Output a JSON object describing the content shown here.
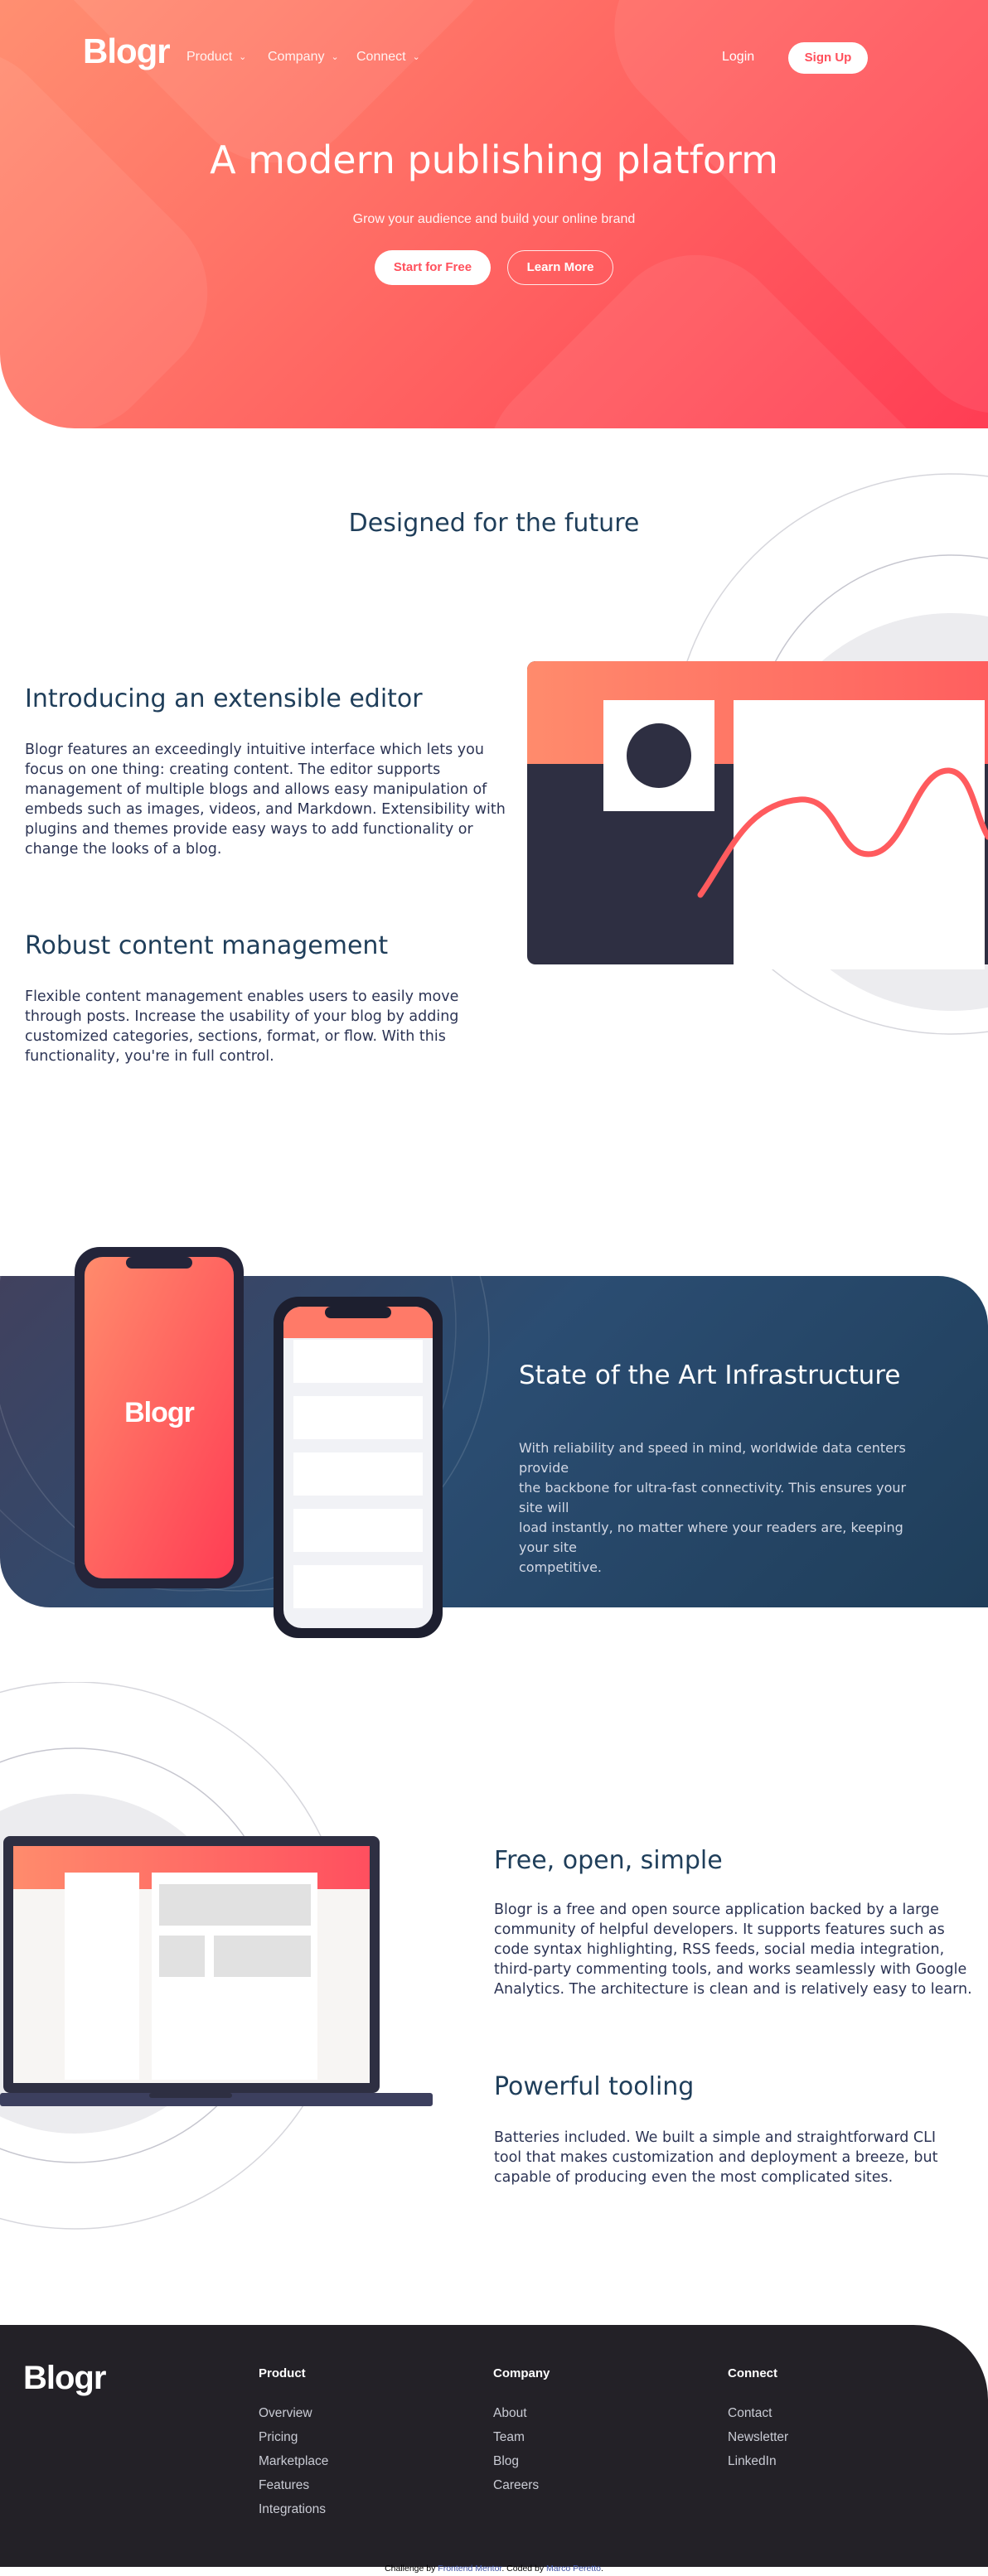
{
  "brand": {
    "name": "Blogr"
  },
  "nav": {
    "items": [
      {
        "label": "Product"
      },
      {
        "label": "Company"
      },
      {
        "label": "Connect"
      }
    ],
    "login_label": "Login",
    "signup_label": "Sign Up"
  },
  "hero": {
    "title": "A modern publishing platform",
    "subtitle": "Grow your audience and build your online brand",
    "primary_cta": "Start for Free",
    "secondary_cta": "Learn More"
  },
  "future": {
    "heading": "Designed for the future",
    "features": [
      {
        "title": "Introducing an extensible editor",
        "lines": [
          "Blogr features an exceedingly intuitive interface which lets you",
          "focus on one thing: creating content. The editor supports",
          "management of multiple blogs and allows easy manipulation of",
          "embeds such as images, videos, and Markdown. Extensibility with",
          "plugins and themes provide easy ways to add functionality or",
          "change the looks of a blog."
        ]
      },
      {
        "title": "Robust content management",
        "lines": [
          "Flexible content management enables users to easily move",
          "through posts. Increase the usability of your blog by adding",
          "customized categories, sections, format, or flow. With this",
          "functionality, you're in full control."
        ]
      }
    ]
  },
  "infrastructure": {
    "title": "State of the Art Infrastructure",
    "lines": [
      "With reliability and speed in mind, worldwide data centers provide",
      "the backbone for ultra-fast connectivity. This ensures your site will",
      "load instantly, no matter where your readers are, keeping your site",
      "competitive."
    ],
    "phone_logo": "Blogr"
  },
  "open_source": {
    "features": [
      {
        "title": "Free, open, simple",
        "lines": [
          "Blogr is a free and open source application backed by a large",
          "community of helpful developers. It supports features such as",
          "code syntax highlighting, RSS feeds, social media integration,",
          "third-party commenting tools, and works seamlessly with Google",
          "Analytics. The architecture is clean and is relatively easy to learn."
        ]
      },
      {
        "title": "Powerful tooling",
        "lines": [
          "Batteries included. We built a simple and straightforward CLI",
          "tool that makes customization and deployment a breeze, but",
          "capable of producing even the most complicated sites."
        ]
      }
    ]
  },
  "footer": {
    "columns": [
      {
        "heading": "Product",
        "links": [
          "Overview",
          "Pricing",
          "Marketplace",
          "Features",
          "Integrations"
        ]
      },
      {
        "heading": "Company",
        "links": [
          "About",
          "Team",
          "Blog",
          "Careers"
        ]
      },
      {
        "heading": "Connect",
        "links": [
          "Contact",
          "Newsletter",
          "LinkedIn"
        ]
      }
    ]
  },
  "attribution": {
    "prefix": "Challenge by ",
    "link1": "Frontend Mentor",
    "middle": ". Coded by ",
    "link2": "Marco Peretto",
    "suffix": "."
  },
  "colors": {
    "hero_start": "#ff8f71",
    "hero_end": "#ff3d54",
    "heading_blue": "#1f3e5a",
    "body_text": "#2c3454",
    "infra_band": "#2b4d72",
    "footer_bg": "#232127",
    "device_dark": "#2e2f42"
  }
}
